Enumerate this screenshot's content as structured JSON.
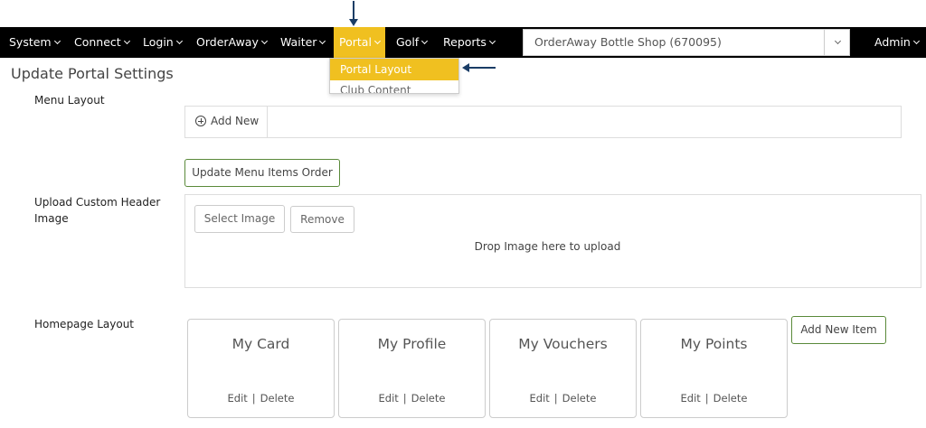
{
  "navbar": {
    "items": [
      {
        "label": "System"
      },
      {
        "label": "Connect"
      },
      {
        "label": "Login"
      },
      {
        "label": "OrderAway"
      },
      {
        "label": "Waiter"
      },
      {
        "label": "Portal"
      },
      {
        "label": "Golf"
      },
      {
        "label": "Reports"
      }
    ],
    "store_select": {
      "value": "OrderAway Bottle Shop (670095)"
    },
    "user": {
      "label": "Admin"
    },
    "active_color": "#f0c020"
  },
  "portal_dropdown": {
    "items": [
      {
        "label": "Portal Layout"
      },
      {
        "label": "Club Content"
      }
    ]
  },
  "page": {
    "title": "Update Portal Settings",
    "menu_layout": {
      "label": "Menu Layout",
      "add_new": "Add New",
      "update_order": "Update Menu Items Order"
    },
    "upload": {
      "label": "Upload Custom Header Image",
      "select_image": "Select Image",
      "remove": "Remove",
      "drop_text": "Drop Image here to upload"
    },
    "homepage": {
      "label": "Homepage Layout",
      "cards": [
        {
          "title": "My Card",
          "edit": "Edit",
          "delete": "Delete"
        },
        {
          "title": "My Profile",
          "edit": "Edit",
          "delete": "Delete"
        },
        {
          "title": "My Vouchers",
          "edit": "Edit",
          "delete": "Delete"
        },
        {
          "title": "My Points",
          "edit": "Edit",
          "delete": "Delete"
        }
      ],
      "add_new_item": "Add New Item",
      "separator": "|"
    }
  }
}
